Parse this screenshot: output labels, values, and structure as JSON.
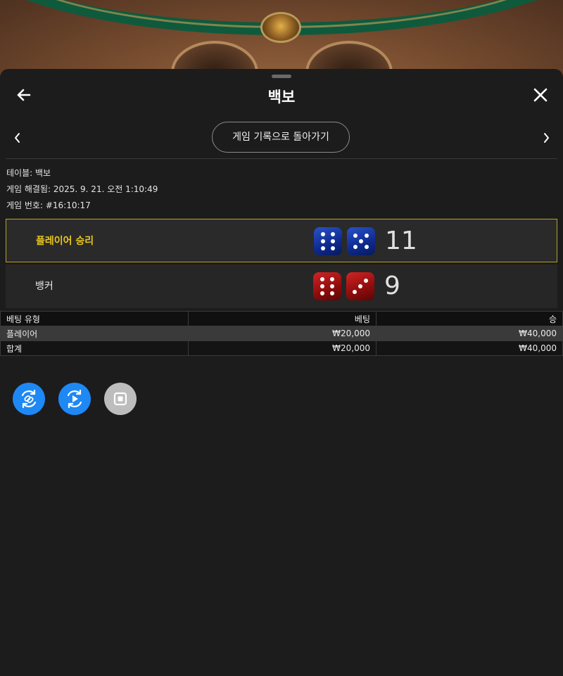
{
  "header": {
    "title": "백보"
  },
  "nav": {
    "history_button": "게임 기록으로 돌아가기"
  },
  "info": {
    "table": "테이블: 백보",
    "resolved": "게임 해결됨: 2025. 9. 21. 오전 1:10:49",
    "game_number": "게임 번호: #16:10:17"
  },
  "results": {
    "player": {
      "label": "플레이어 승리",
      "dice": [
        6,
        5
      ],
      "total": "11",
      "die_color": "blue",
      "accent": "#e8c61c"
    },
    "banker": {
      "label": "뱅커",
      "dice": [
        6,
        3
      ],
      "total": "9",
      "die_color": "red"
    }
  },
  "bets_table": {
    "headers": [
      "베팅 유형",
      "베팅",
      "승"
    ],
    "rows": [
      [
        "플레이어",
        "₩20,000",
        "₩40,000"
      ],
      [
        "합계",
        "₩20,000",
        "₩40,000"
      ]
    ]
  },
  "actions": [
    {
      "icon": "replay-link-icon",
      "color": "#1e88f5"
    },
    {
      "icon": "video-replay-icon",
      "color": "#1e88f5"
    },
    {
      "icon": "stop-icon",
      "color": "#bdbdbd"
    }
  ]
}
